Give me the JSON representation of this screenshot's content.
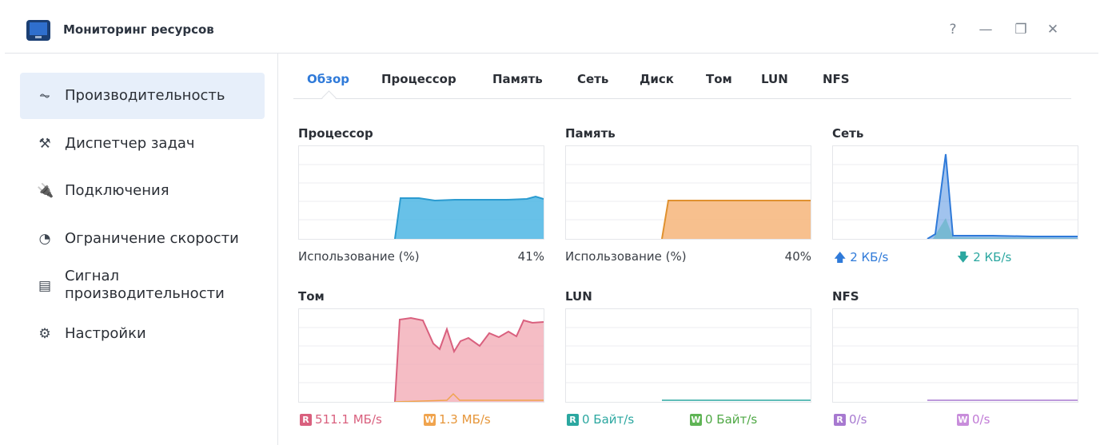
{
  "window": {
    "title": "Мониторинг ресурсов",
    "buttons": {
      "help": "?",
      "minimize": "—",
      "restore": "❐",
      "close": "✕"
    }
  },
  "sidebar": {
    "items": [
      {
        "label": "Производительность",
        "icon": "performance-chart-icon",
        "glyph": "⏦",
        "active": true
      },
      {
        "label": "Диспетчер задач",
        "icon": "task-manager-icon",
        "glyph": "⚒",
        "active": false
      },
      {
        "label": "Подключения",
        "icon": "plug-icon",
        "glyph": "🔌",
        "active": false
      },
      {
        "label": "Ограничение скорости",
        "icon": "speed-gauge-icon",
        "glyph": "◔",
        "active": false
      },
      {
        "label": "Сигнал производительности",
        "icon": "alert-document-icon",
        "glyph": "▤",
        "active": false
      },
      {
        "label": "Настройки",
        "icon": "gear-icon",
        "glyph": "⚙",
        "active": false
      }
    ]
  },
  "tabs": [
    {
      "label": "Обзор",
      "active": true
    },
    {
      "label": "Процессор",
      "active": false
    },
    {
      "label": "Память",
      "active": false
    },
    {
      "label": "Сеть",
      "active": false
    },
    {
      "label": "Диск",
      "active": false
    },
    {
      "label": "Том",
      "active": false
    },
    {
      "label": "LUN",
      "active": false
    },
    {
      "label": "NFS",
      "active": false
    }
  ],
  "panels": {
    "cpu": {
      "title": "Процессор",
      "usage_label": "Использование (%)",
      "usage_value": "41%"
    },
    "memory": {
      "title": "Память",
      "usage_label": "Использование (%)",
      "usage_value": "40%"
    },
    "network": {
      "title": "Сеть",
      "upload": "2 КБ/s",
      "download": "2 КБ/s",
      "upload_icon": "arrow-up-icon",
      "download_icon": "arrow-down-icon"
    },
    "volume": {
      "title": "Том",
      "read_badge": "R",
      "read": "511.1 МБ/s",
      "write_badge": "W",
      "write": "1.3 МБ/s"
    },
    "lun": {
      "title": "LUN",
      "read_badge": "R",
      "read": "0 Байт/s",
      "write_badge": "W",
      "write": "0 Байт/s"
    },
    "nfs": {
      "title": "NFS",
      "read_badge": "R",
      "read": "0/s",
      "write_badge": "W",
      "write": "0/s"
    }
  },
  "colors": {
    "accent": "#2f7ad9",
    "cpu": "#4db6e4",
    "memory": "#f0a44e",
    "network_up": "#2f7ad9",
    "network_down": "#2ba7a0",
    "volume_read": "#d9607e",
    "volume_write": "#f0a44e",
    "lun_read": "#2ba7a0",
    "lun_write": "#5fb455",
    "nfs": "#a779d0"
  }
}
